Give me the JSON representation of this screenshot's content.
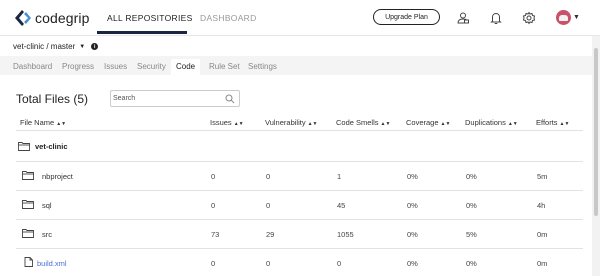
{
  "app": {
    "name": "codegrip",
    "brand_color": "#1c2541"
  },
  "topnav": {
    "tabs": [
      {
        "label": "ALL REPOSITORIES",
        "active": true
      },
      {
        "label": "DASHBOARD",
        "active": false
      }
    ],
    "upgrade_label": "Upgrade Plan",
    "icons": [
      "team-icon",
      "bell-icon",
      "gear-icon",
      "user-avatar"
    ]
  },
  "breadcrumb": {
    "repo": "vet-clinic / master"
  },
  "subtabs": [
    {
      "label": "Dashboard",
      "active": false
    },
    {
      "label": "Progress",
      "active": false
    },
    {
      "label": "Issues",
      "active": false
    },
    {
      "label": "Security",
      "active": false
    },
    {
      "label": "Code",
      "active": true
    },
    {
      "label": "Rule Set",
      "active": false
    },
    {
      "label": "Settings",
      "active": false
    }
  ],
  "files": {
    "title": "Total Files (5)",
    "search_placeholder": "Search",
    "columns": [
      "File Name",
      "Issues",
      "Vulnerability",
      "Code Smells",
      "Coverage",
      "Duplications",
      "Efforts"
    ],
    "root_folder": "vet-clinic",
    "rows": [
      {
        "type": "folder",
        "name": "nbproject",
        "issues": "0",
        "vulnerability": "0",
        "code_smells": "1",
        "coverage": "0%",
        "duplications": "0%",
        "efforts": "5m"
      },
      {
        "type": "folder",
        "name": "sql",
        "issues": "0",
        "vulnerability": "0",
        "code_smells": "45",
        "coverage": "0%",
        "duplications": "0%",
        "efforts": "4h"
      },
      {
        "type": "folder",
        "name": "src",
        "issues": "73",
        "vulnerability": "29",
        "code_smells": "1055",
        "coverage": "0%",
        "duplications": "5%",
        "efforts": "0m"
      },
      {
        "type": "file",
        "name": "build.xml",
        "issues": "0",
        "vulnerability": "0",
        "code_smells": "0",
        "coverage": "0%",
        "duplications": "0%",
        "efforts": "0m"
      }
    ]
  }
}
